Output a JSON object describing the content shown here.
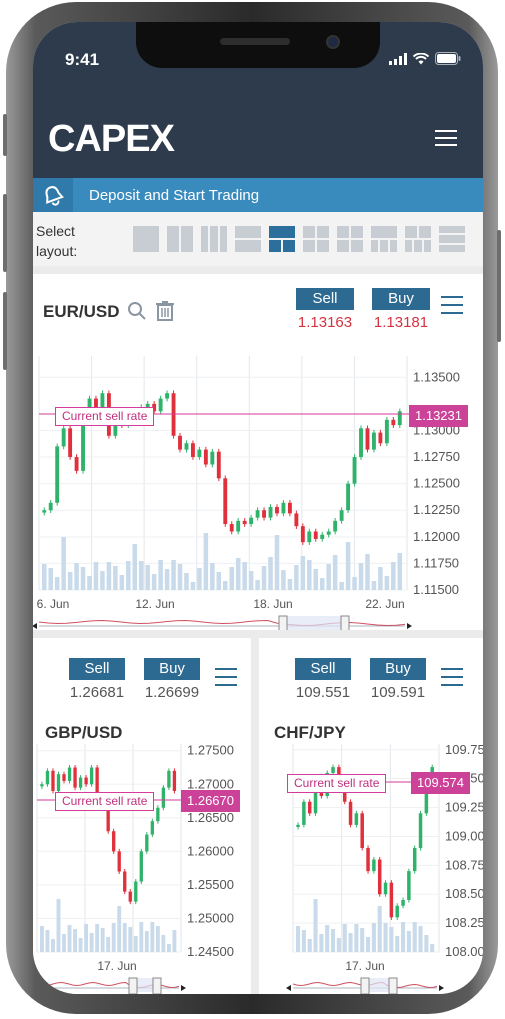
{
  "status": {
    "time": "9:41"
  },
  "header": {
    "logo": "CAPEX"
  },
  "banner": {
    "text": "Deposit and Start Trading"
  },
  "layout": {
    "label_line1": "Select",
    "label_line2": "layout:",
    "active_index": 4
  },
  "main_chart": {
    "pair": "EUR/USD",
    "sell_label": "Sell",
    "buy_label": "Buy",
    "sell_price": "1.13163",
    "buy_price": "1.13181",
    "current_sell_label": "Current sell rate",
    "current_rate": "1.13231"
  },
  "gbp_chart": {
    "pair": "GBP/USD",
    "sell_label": "Sell",
    "buy_label": "Buy",
    "sell_price": "1.26681",
    "buy_price": "1.26699",
    "current_sell_label": "Current sell rate",
    "current_rate": "1.26670"
  },
  "chf_chart": {
    "pair": "CHF/JPY",
    "sell_label": "Sell",
    "buy_label": "Buy",
    "sell_price": "109.551",
    "buy_price": "109.591",
    "current_sell_label": "Current sell rate",
    "current_rate": "109.574"
  },
  "chart_data": [
    {
      "type": "candlestick",
      "series_label": "EUR/USD",
      "x_ticks": [
        "6. Jun",
        "12. Jun",
        "18. Jun",
        "22. Jun"
      ],
      "y_ticks": [
        1.135,
        1.13,
        1.1275,
        1.125,
        1.1225,
        1.12,
        1.1175,
        1.115
      ],
      "y_tick_labels": [
        "1.13500",
        "1.13000",
        "1.12750",
        "1.12500",
        "1.12250",
        "1.12000",
        "1.11750",
        "1.11500"
      ],
      "ylim": [
        1.115,
        1.137
      ],
      "close": [
        1.1225,
        1.1232,
        1.1285,
        1.1302,
        1.1275,
        1.1262,
        1.1318,
        1.133,
        1.1322,
        1.1335,
        1.1295,
        1.131,
        1.1305,
        1.1318,
        1.1312,
        1.1322,
        1.1325,
        1.1318,
        1.133,
        1.1335,
        1.1295,
        1.1282,
        1.1288,
        1.1275,
        1.1282,
        1.1268,
        1.128,
        1.1255,
        1.1212,
        1.1205,
        1.1215,
        1.1212,
        1.1218,
        1.1225,
        1.1218,
        1.1228,
        1.1222,
        1.1232,
        1.1222,
        1.121,
        1.1195,
        1.1205,
        1.1198,
        1.1202,
        1.1205,
        1.1215,
        1.1225,
        1.125,
        1.1275,
        1.1302,
        1.1282,
        1.1298,
        1.1288,
        1.131,
        1.1305,
        1.1318
      ]
    },
    {
      "type": "candlestick",
      "series_label": "GBP/USD",
      "x_ticks": [
        "17. Jun"
      ],
      "y_ticks": [
        1.275,
        1.27,
        1.265,
        1.26,
        1.255,
        1.25,
        1.245
      ],
      "y_tick_labels": [
        "1.27500",
        "1.27000",
        "1.26500",
        "1.26000",
        "1.25500",
        "1.25000",
        "1.24500"
      ],
      "ylim": [
        1.245,
        1.276
      ],
      "close": [
        1.27,
        1.272,
        1.269,
        1.2715,
        1.2705,
        1.2725,
        1.2695,
        1.271,
        1.27,
        1.2725,
        1.268,
        1.2665,
        1.263,
        1.26,
        1.257,
        1.254,
        1.2525,
        1.2555,
        1.26,
        1.2625,
        1.2645,
        1.2665,
        1.2695,
        1.272,
        1.269
      ]
    },
    {
      "type": "candlestick",
      "series_label": "CHF/JPY",
      "x_ticks": [
        "17. Jun"
      ],
      "y_ticks": [
        109.75,
        109.5,
        109.25,
        109.0,
        108.75,
        108.5,
        108.25,
        108.0
      ],
      "y_tick_labels": [
        "109.750",
        "109.500",
        "109.250",
        "109.000",
        "108.750",
        "108.500",
        "108.250",
        "108.000"
      ],
      "ylim": [
        108.0,
        109.8
      ],
      "close": [
        109.1,
        109.3,
        109.2,
        109.5,
        109.35,
        109.55,
        109.6,
        109.4,
        109.3,
        109.1,
        109.2,
        108.9,
        108.7,
        108.8,
        108.5,
        108.6,
        108.3,
        108.4,
        108.45,
        108.7,
        108.9,
        109.2,
        109.4,
        109.6
      ]
    }
  ]
}
